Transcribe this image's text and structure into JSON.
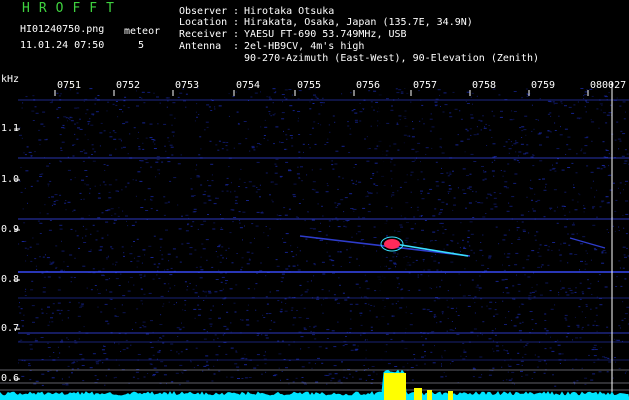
{
  "app_title": "HROFFT",
  "file_name": "HI01240750.png",
  "mode_label": "meteor",
  "timestamp": "11.01.24 07:50",
  "meteor_count": "5",
  "info": {
    "observer_key": "Observer",
    "observer_val": "Hirotaka Otsuka",
    "location_key": "Location",
    "location_val": "Hirakata, Osaka, Japan (135.7E, 34.9N)",
    "receiver_key": "Receiver",
    "receiver_val": "YAESU FT-690 53.749MHz, USB",
    "antenna_key": "Antenna",
    "antenna_val": "2el-HB9CV, 4m's high",
    "antenna_val2": "90-270-Azimuth (East-West), 90-Elevation (Zenith)"
  },
  "y_unit": "kHz",
  "time_labels": [
    "0751",
    "0752",
    "0753",
    "0754",
    "0755",
    "0756",
    "0757",
    "0758",
    "0759",
    "080027"
  ],
  "freq_labels": [
    "1.1",
    "1.0",
    "0.9",
    "0.8",
    "0.7",
    "0.6"
  ],
  "colors": {
    "background": "#000000",
    "noise": "#1a2bb0",
    "carrier": "#3a4cff",
    "echo_core": "#ff2a5a",
    "echo_tail": "#39e0ff",
    "power_trace": "#ffff00",
    "baseline": "#00e5ff",
    "title_green": "#3fd23f"
  }
}
